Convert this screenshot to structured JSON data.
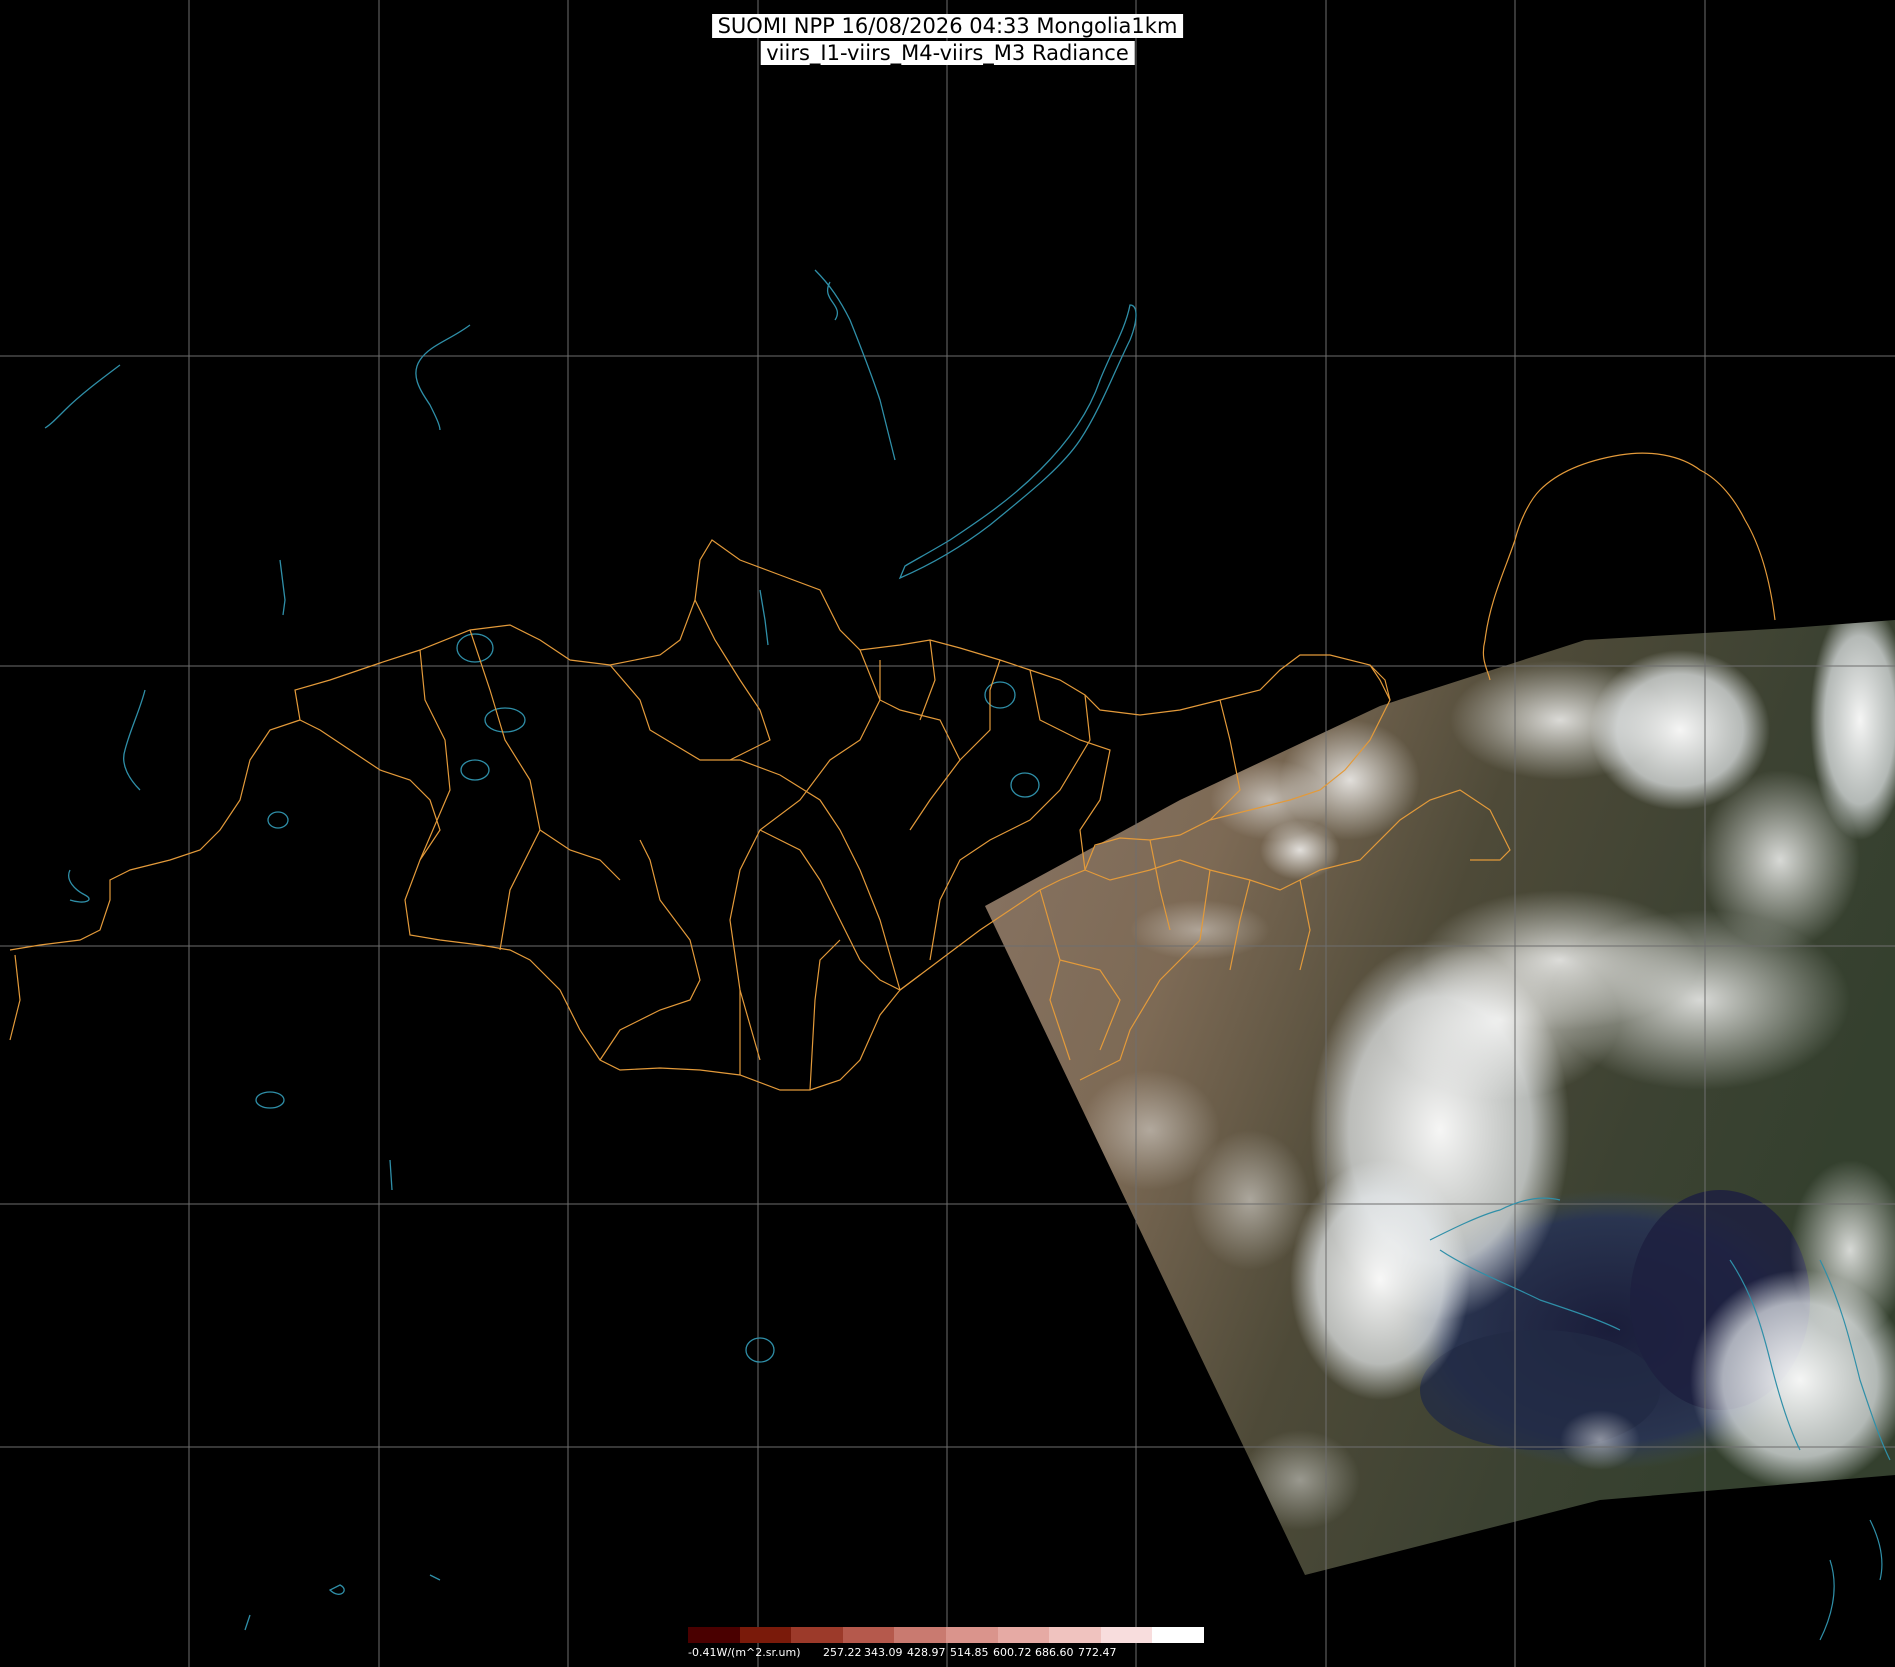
{
  "title": {
    "line1": "SUOMI NPP 16/08/2026 04:33 Mongolia1km",
    "line2": "viirs_I1-viirs_M4-viirs_M3 Radiance"
  },
  "colors": {
    "background": "#000000",
    "grid": "#6e6e6e",
    "borders": "#e39a3a",
    "water": "#2f8fa8",
    "imagery_land": "#7a6a55",
    "imagery_cloud": "#f2f4f6",
    "imagery_sea": "#1e2440"
  },
  "colorbar": {
    "colors": [
      "#4a0000",
      "#7a1a0a",
      "#9c3a2a",
      "#b5594c",
      "#c97a70",
      "#da948c",
      "#e6aaa4",
      "#f0c3bf",
      "#f8dddd",
      "#ffffff"
    ],
    "labels": [
      "-0.41W/(m^2.sr.um)",
      "257.22",
      "343.09",
      "428.97",
      "514.85",
      "600.72",
      "686.60",
      "772.47"
    ]
  }
}
